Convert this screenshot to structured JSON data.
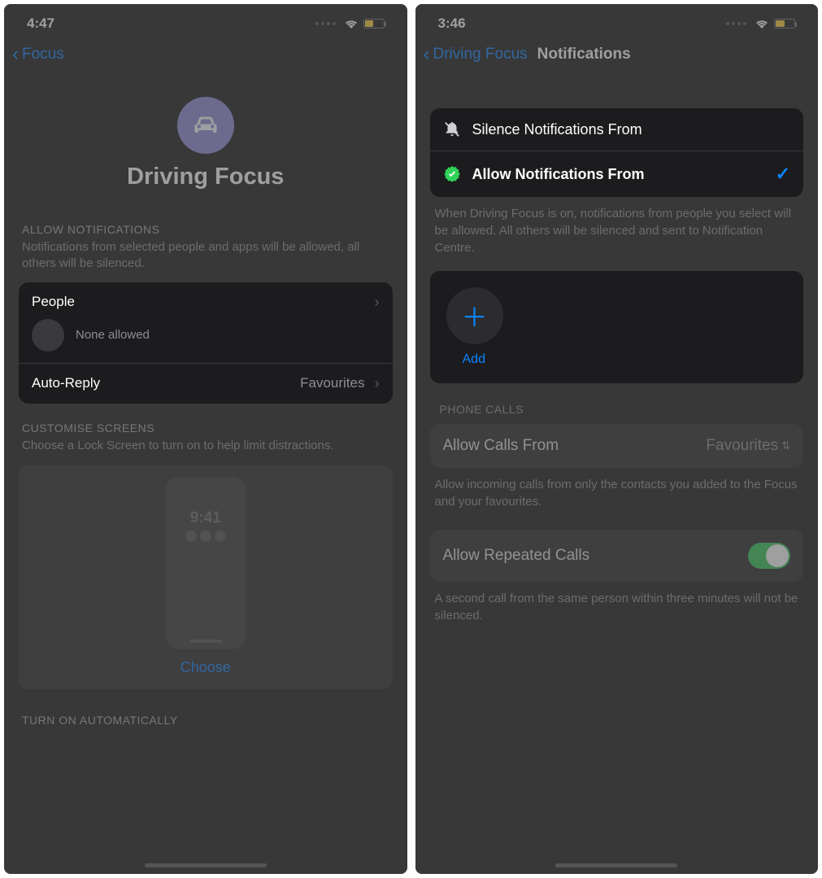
{
  "left": {
    "statusbar": {
      "time": "4:47"
    },
    "nav": {
      "back": "Focus"
    },
    "hero": {
      "title": "Driving Focus"
    },
    "allow_notif": {
      "header": "ALLOW NOTIFICATIONS",
      "desc": "Notifications from selected people and apps will be allowed, all others will be silenced."
    },
    "people": {
      "label": "People",
      "none": "None allowed"
    },
    "autoreply": {
      "label": "Auto-Reply",
      "value": "Favourites"
    },
    "customise": {
      "header": "CUSTOMISE SCREENS",
      "desc": "Choose a Lock Screen to turn on to help limit distractions."
    },
    "lockscreen": {
      "time": "9:41",
      "choose": "Choose"
    },
    "turnon": "TURN ON AUTOMATICALLY"
  },
  "right": {
    "statusbar": {
      "time": "3:46"
    },
    "nav": {
      "back": "Driving Focus",
      "title": "Notifications"
    },
    "modes": {
      "silence": "Silence Notifications From",
      "allow": "Allow Notifications From"
    },
    "modes_footer": "When Driving Focus is on, notifications from people you select will be allowed. All others will be silenced and sent to Notification Centre.",
    "add": "Add",
    "phone_calls_header": "PHONE CALLS",
    "allow_calls": {
      "label": "Allow Calls From",
      "value": "Favourites"
    },
    "allow_calls_footer": "Allow incoming calls from only the contacts you added to the Focus and your favourites.",
    "repeated": {
      "label": "Allow Repeated Calls"
    },
    "repeated_footer": "A second call from the same person within three minutes will not be silenced."
  }
}
